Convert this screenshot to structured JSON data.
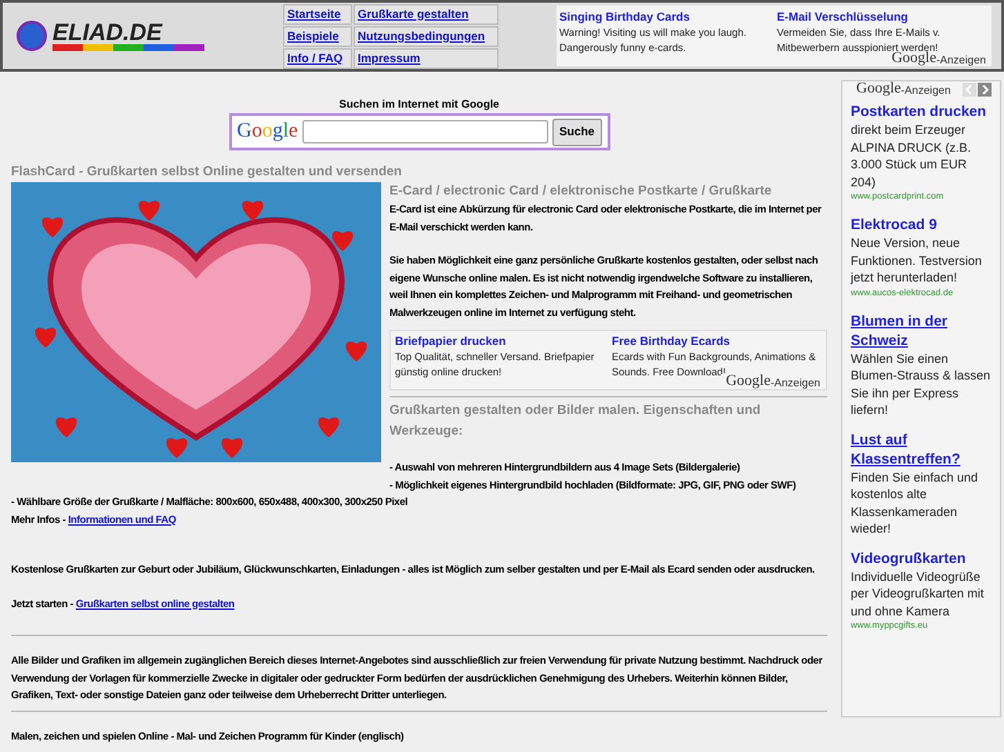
{
  "logo": {
    "text": "ELIAD.DE"
  },
  "nav": [
    {
      "label": "Startseite"
    },
    {
      "label": "Grußkarte gestalten"
    },
    {
      "label": "Beispiele"
    },
    {
      "label": "Nutzungsbedingungen"
    },
    {
      "label": "Info / FAQ"
    },
    {
      "label": "Impressum"
    }
  ],
  "top_ads": {
    "items": [
      {
        "title": "Singing Birthday Cards",
        "text": "Warning! Visiting us will make you laugh. Dangerously funny e-cards."
      },
      {
        "title": "E-Mail Verschlüsselung",
        "text": "Vermeiden Sie, dass Ihre E-Mails v. Mitbewerbern ausspioniert werden!"
      }
    ],
    "badge_logo": "Google",
    "badge_label": "-Anzeigen"
  },
  "search": {
    "title": "Suchen im Internet mit Google",
    "logo": "Google",
    "button": "Suche"
  },
  "page_title": "FlashCard - Grußkarten selbst Online gestalten und versenden",
  "intro": {
    "heading": "E-Card / electronic Card / elektronische Postkarte / Grußkarte",
    "paragraphs": [
      "E-Card ist eine Abkürzung für electronic Card oder elektronische Postkarte, die im Internet per E-Mail verschickt werden kann.",
      "Sie haben Möglichkeit eine ganz persönliche Grußkarte kostenlos gestalten, oder selbst nach eigene Wunsche online malen. Es ist nicht notwendig irgendwelche Software zu installieren, weil Ihnen ein komplettes Zeichen- und Malprogramm mit Freihand- und geometrischen Malwerkzeugen online im Internet zu verfügung steht."
    ]
  },
  "inline_ads": {
    "items": [
      {
        "title": "Briefpapier drucken",
        "text": "Top Qualität, schneller Versand. Briefpapier günstig online drucken!"
      },
      {
        "title": "Free Birthday Ecards",
        "text": "Ecards with Fun Backgrounds, Animations & Sounds. Free Download!"
      }
    ],
    "badge_logo": "Google",
    "badge_label": "-Anzeigen"
  },
  "features": {
    "heading": "Grußkarten gestalten oder Bilder malen. Eigenschaften und Werkzeuge:",
    "lines": [
      "- Auswahl von mehreren Hintergrundbildern aus 4 Image Sets (Bildergalerie)",
      "- Möglichkeit eigenes Hintergrundbild hochladen (Bildformate: JPG, GIF, PNG oder SWF)",
      "- Wählbare Größe der Grußkarte / Malfläche: 800x600, 650x488, 400x300, 300x250 Pixel"
    ],
    "more_label": "Mehr Infos - ",
    "more_link": "Informationen und FAQ"
  },
  "occasions": "Kostenlose Grußkarten zur Geburt oder Jubiläum, Glückwunschkarten, Einladungen - alles ist Möglich zum selber gestalten und per E-Mail als Ecard senden oder ausdrucken.",
  "start": {
    "label": "Jetzt starten - ",
    "link": "Grußkarten selbst online gestalten"
  },
  "copyright": "Alle Bilder und Grafiken im allgemein zugänglichen Bereich dieses Internet-Angebotes sind ausschließlich zur freien Verwendung für private Nutzung bestimmt. Nachdruck oder Verwendung der Vorlagen für kommerzielle Zwecke in digitaler oder gedruckter Form bedürfen der ausdrücklichen Genehmigung des Urhebers. Weiterhin können Bilder, Grafiken, Text- oder sonstige Dateien ganz oder teilweise dem Urheberrecht Dritter unterliegen.",
  "footer_link_line": "Malen, zeichen und spielen Online - Mal- und Zeichen Programm für Kinder (englisch)",
  "sidebar": {
    "badge_logo": "Google",
    "badge_label": "-Anzeigen",
    "prev_disabled": true,
    "next_disabled": false,
    "ads": [
      {
        "title": "Postkarten drucken",
        "underlined": false,
        "text": "direkt beim Erzeuger ALPINA DRUCK (z.B. 3.000 Stück um EUR 204)",
        "url": "www.postcardprint.com"
      },
      {
        "title": "Elektrocad 9",
        "underlined": false,
        "text": "Neue Version, neue Funktionen. Testversion jetzt herunterladen!",
        "url": "www.aucos-elektrocad.de"
      },
      {
        "title": "Blumen in der Schweiz",
        "underlined": true,
        "text": "Wählen Sie einen Blumen-Strauss & lassen Sie ihn per Express liefern!"
      },
      {
        "title": "Lust auf Klassentreffen?",
        "underlined": true,
        "text": "Finden Sie einfach und kostenlos alte Klassenkameraden wieder!"
      },
      {
        "title": "Videogrußkarten",
        "underlined": false,
        "text": "Individuelle Videogrüße per Videogrußkarten mit und ohne Kamera",
        "url": "www.myppcgifts.eu"
      }
    ]
  }
}
